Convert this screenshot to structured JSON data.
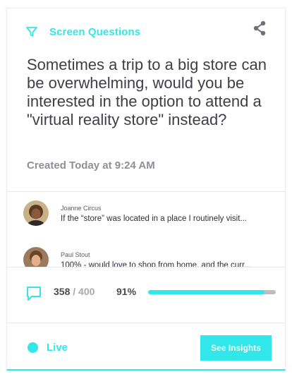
{
  "header": {
    "title": "Screen Questions",
    "filter_icon": "filter-icon",
    "share_icon": "share-icon"
  },
  "question": {
    "text": "Sometimes a trip to a big store can be overwhelming, would you be interested in the option to attend a \"virtual reality store\" instead?",
    "created": "Created Today at 9:24 AM"
  },
  "responses": [
    {
      "name": "Joanne Circus",
      "text": "If the “store” was located in a place I routinely visit..."
    },
    {
      "name": "Paul Stout",
      "text": "100% - would love to shop from home, and the curr..."
    }
  ],
  "stats": {
    "count": "358",
    "total": "/ 400",
    "percent_label": "91%",
    "progress": 0.91
  },
  "footer": {
    "status_label": "Live",
    "insights_label": "See Insights"
  },
  "colors": {
    "accent": "#31e7ea",
    "text": "#3e3e48",
    "muted": "#8e8e96"
  }
}
